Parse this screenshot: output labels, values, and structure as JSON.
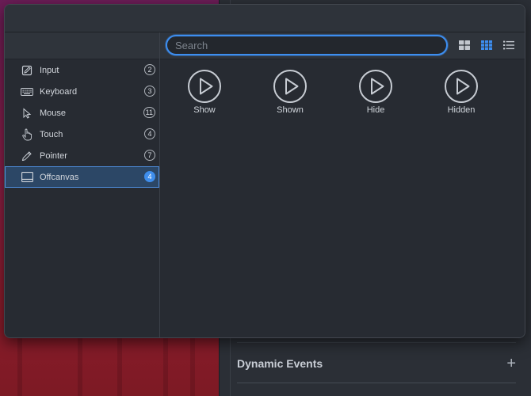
{
  "background": {
    "section_title": "Dynamic Events",
    "add_symbol": "+"
  },
  "search": {
    "placeholder": "Search",
    "value": ""
  },
  "view_modes": [
    {
      "name": "large-grid-view",
      "active": false
    },
    {
      "name": "small-grid-view",
      "active": true
    },
    {
      "name": "list-view",
      "active": false
    }
  ],
  "sidebar": {
    "items": [
      {
        "label": "Input",
        "count": "2",
        "icon": "pencil-square-icon"
      },
      {
        "label": "Keyboard",
        "count": "3",
        "icon": "keyboard-icon"
      },
      {
        "label": "Mouse",
        "count": "11",
        "icon": "cursor-arrow-icon"
      },
      {
        "label": "Touch",
        "count": "4",
        "icon": "hand-pointer-icon"
      },
      {
        "label": "Pointer",
        "count": "7",
        "icon": "pen-icon"
      },
      {
        "label": "Offcanvas",
        "count": "4",
        "icon": "panel-icon",
        "selected": true
      }
    ]
  },
  "events": [
    {
      "label": "Show",
      "icon": "play-circle-icon"
    },
    {
      "label": "Shown",
      "icon": "play-circle-icon"
    },
    {
      "label": "Hide",
      "icon": "play-circle-icon"
    },
    {
      "label": "Hidden",
      "icon": "play-circle-icon"
    }
  ],
  "colors": {
    "accent": "#3d8ef0",
    "selection_bg": "#2c4766",
    "panel_bg": "#272b32"
  }
}
